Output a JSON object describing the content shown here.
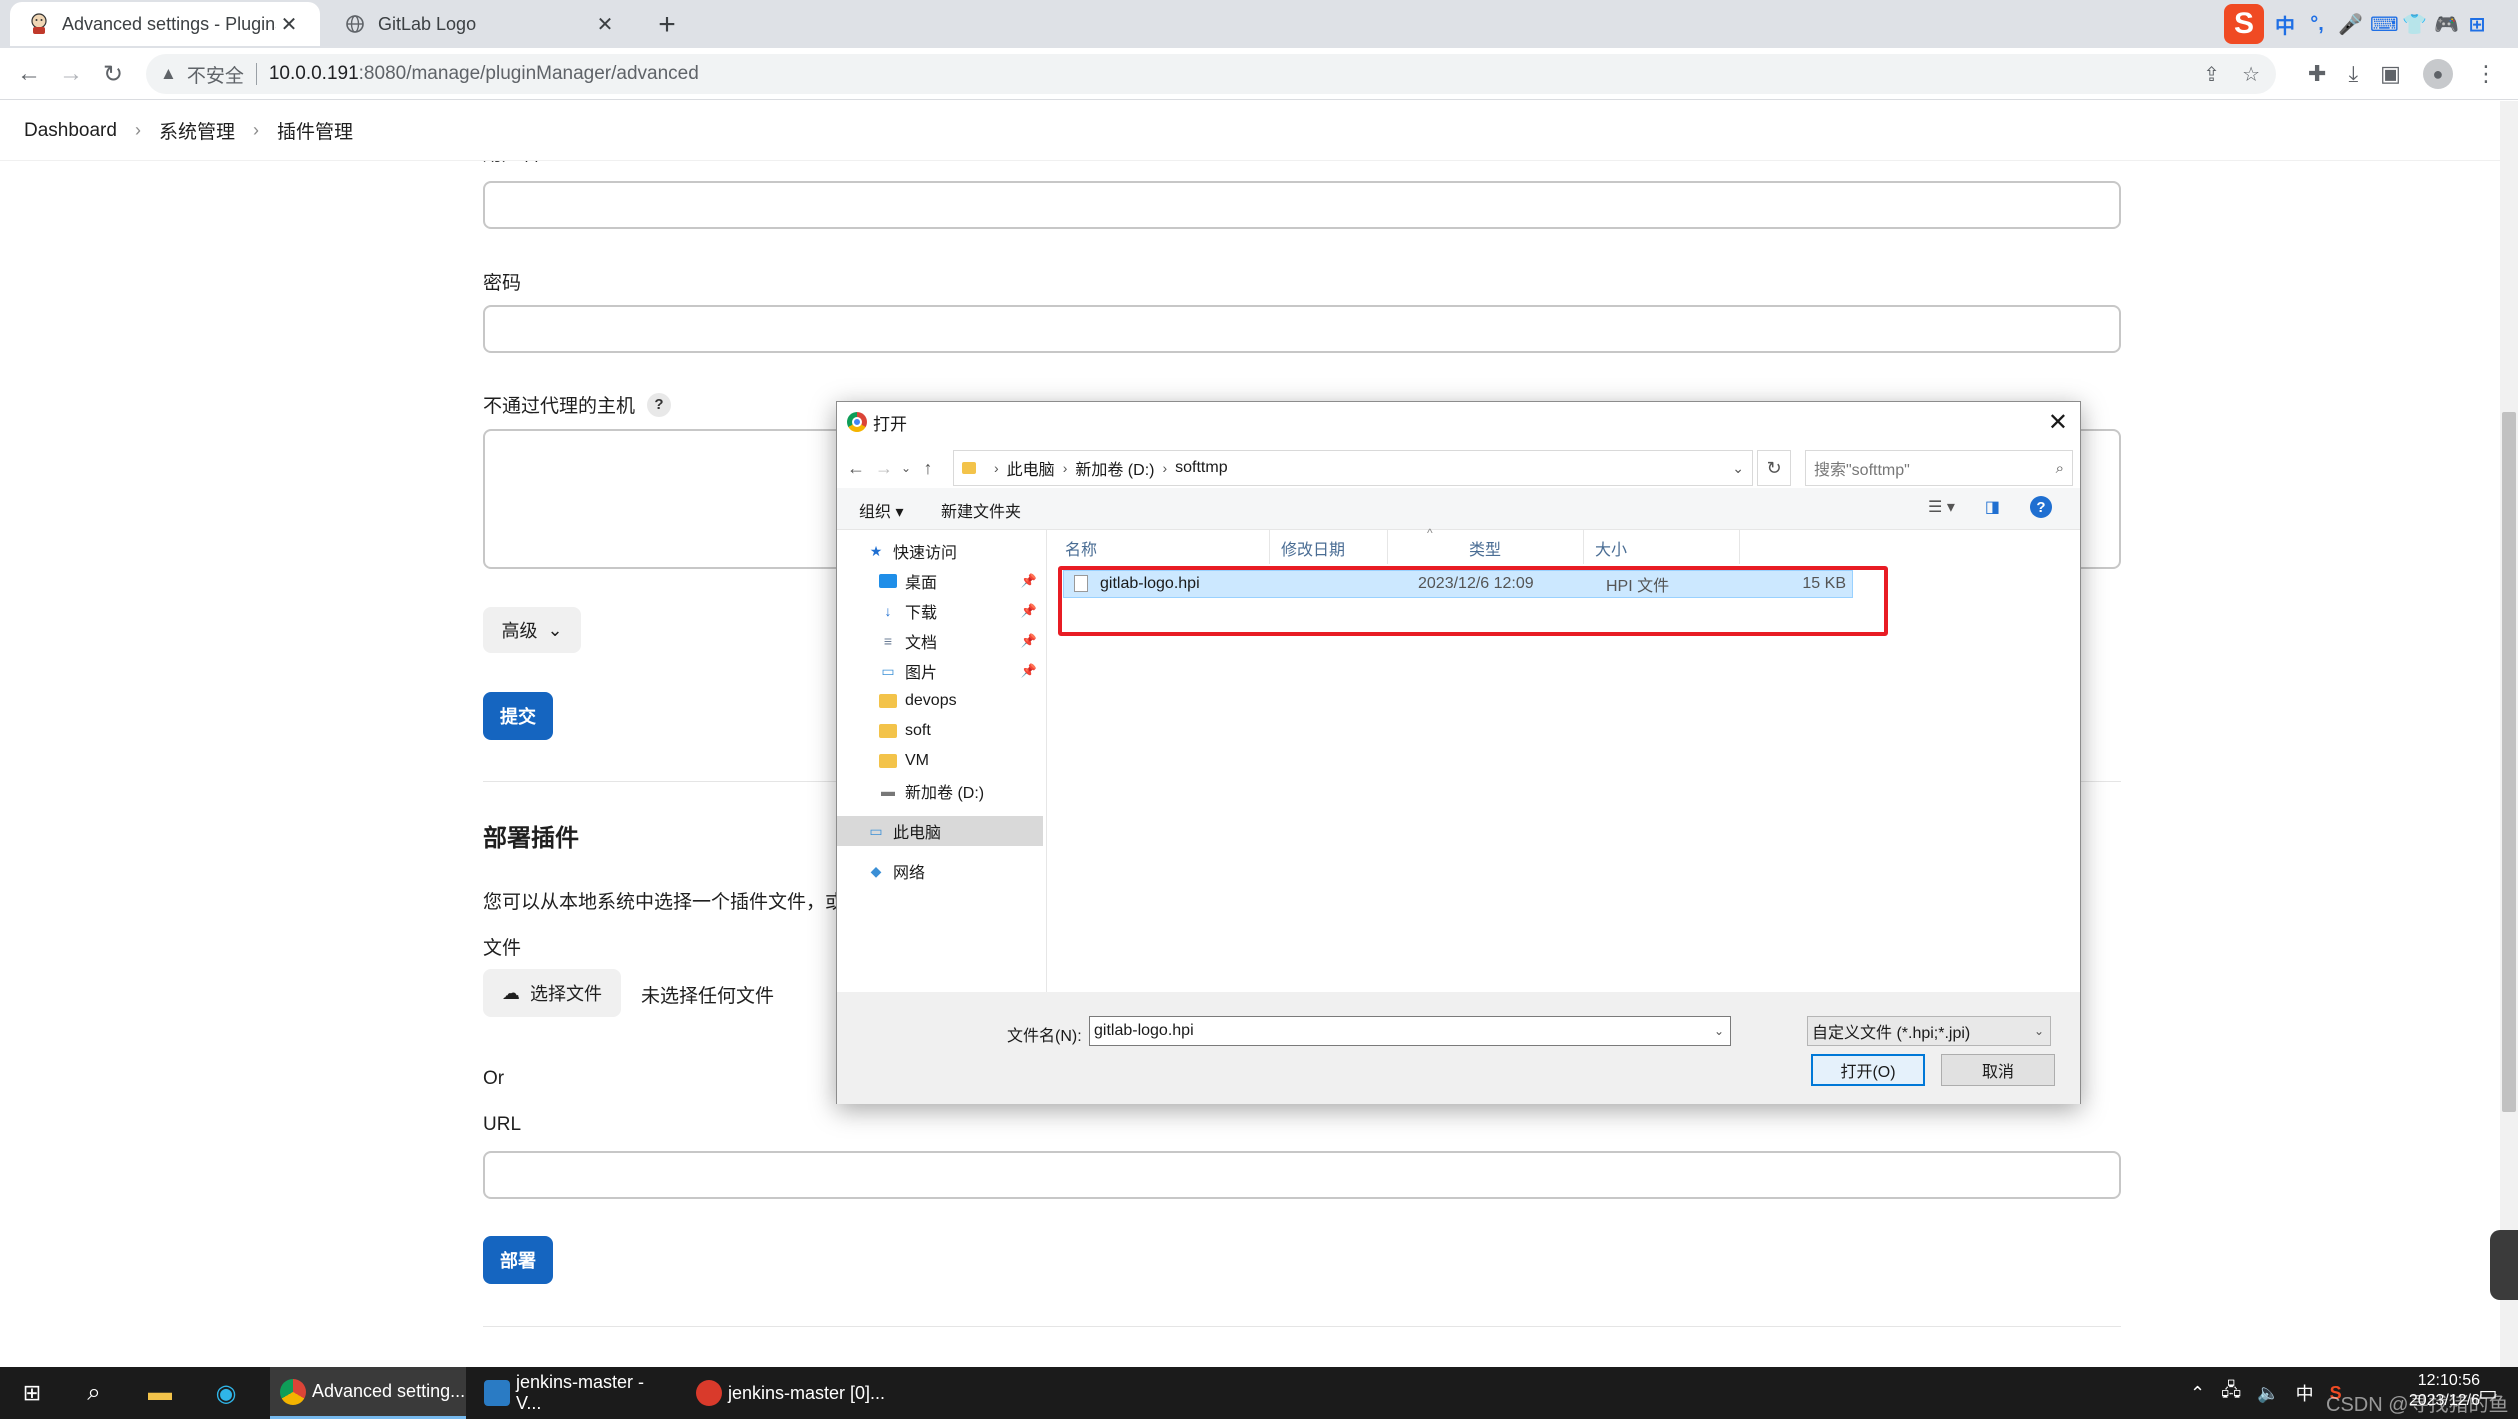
{
  "browser": {
    "tabs": [
      {
        "title": "Advanced settings - Plugins [Jenkins]",
        "active": true
      },
      {
        "title": "GitLab Logo",
        "active": false
      }
    ],
    "address": {
      "security_label": "不安全",
      "host": "10.0.0.191",
      "path": ":8080/manage/pluginManager/advanced"
    },
    "ime": {
      "items": [
        "中",
        "°,",
        "🎤",
        "⌨",
        "👕",
        "🎮",
        "⊞"
      ]
    }
  },
  "breadcrumb": [
    "Dashboard",
    "系统管理",
    "插件管理"
  ],
  "form": {
    "username_label_partial": "用户名",
    "password_label": "密码",
    "no_proxy_label": "不通过代理的主机",
    "help_glyph": "?",
    "advanced_label": "高级",
    "submit_label": "提交"
  },
  "deploy": {
    "title": "部署插件",
    "description": "您可以从本地系统中选择一个插件文件，或者",
    "file_label": "文件",
    "choose_file_label": "选择文件",
    "no_file_text": "未选择任何文件",
    "or_text": "Or",
    "url_label": "URL",
    "deploy_button": "部署"
  },
  "dialog": {
    "title": "打开",
    "breadcrumb": [
      "此电脑",
      "新加卷 (D:)",
      "softtmp"
    ],
    "search_placeholder": "搜索\"softtmp\"",
    "toolbar": {
      "organize": "组织",
      "new_folder": "新建文件夹"
    },
    "nav": [
      {
        "label": "快速访问",
        "icon": "star-icon",
        "pinned": false,
        "indent": 0
      },
      {
        "label": "桌面",
        "icon": "desktop-icon",
        "pinned": true,
        "indent": 1
      },
      {
        "label": "下载",
        "icon": "download-icon",
        "pinned": true,
        "indent": 1
      },
      {
        "label": "文档",
        "icon": "document-icon",
        "pinned": true,
        "indent": 1
      },
      {
        "label": "图片",
        "icon": "picture-icon",
        "pinned": true,
        "indent": 1
      },
      {
        "label": "devops",
        "icon": "folder-icon",
        "pinned": false,
        "indent": 1
      },
      {
        "label": "soft",
        "icon": "folder-icon",
        "pinned": false,
        "indent": 1
      },
      {
        "label": "VM",
        "icon": "folder-icon",
        "pinned": false,
        "indent": 1
      },
      {
        "label": "新加卷 (D:)",
        "icon": "drive-icon",
        "pinned": false,
        "indent": 1
      },
      {
        "label": "此电脑",
        "icon": "computer-icon",
        "pinned": false,
        "indent": 0,
        "selected": true
      },
      {
        "label": "网络",
        "icon": "network-icon",
        "pinned": false,
        "indent": 0
      }
    ],
    "columns": [
      "名称",
      "修改日期",
      "类型",
      "大小"
    ],
    "files": [
      {
        "name": "gitlab-logo.hpi",
        "modified": "2023/12/6 12:09",
        "type": "HPI 文件",
        "size": "15 KB"
      }
    ],
    "filename_label": "文件名(N):",
    "filename_value": "gitlab-logo.hpi",
    "filetype_value": "自定义文件 (*.hpi;*.jpi)",
    "open_button": "打开(O)",
    "cancel_button": "取消"
  },
  "taskbar": {
    "apps": [
      {
        "label": "Advanced setting...",
        "active": true
      },
      {
        "label": "jenkins-master - V...",
        "active": false
      },
      {
        "label": "jenkins-master [0]...",
        "active": false
      }
    ],
    "tray_ime": "中",
    "time": "12:10:56",
    "date": "2023/12/6"
  },
  "watermark": "CSDN @寻找猪的鱼",
  "colors": {
    "accent": "#1565c0",
    "highlight": "#e81c24",
    "selection": "#cce8ff"
  }
}
